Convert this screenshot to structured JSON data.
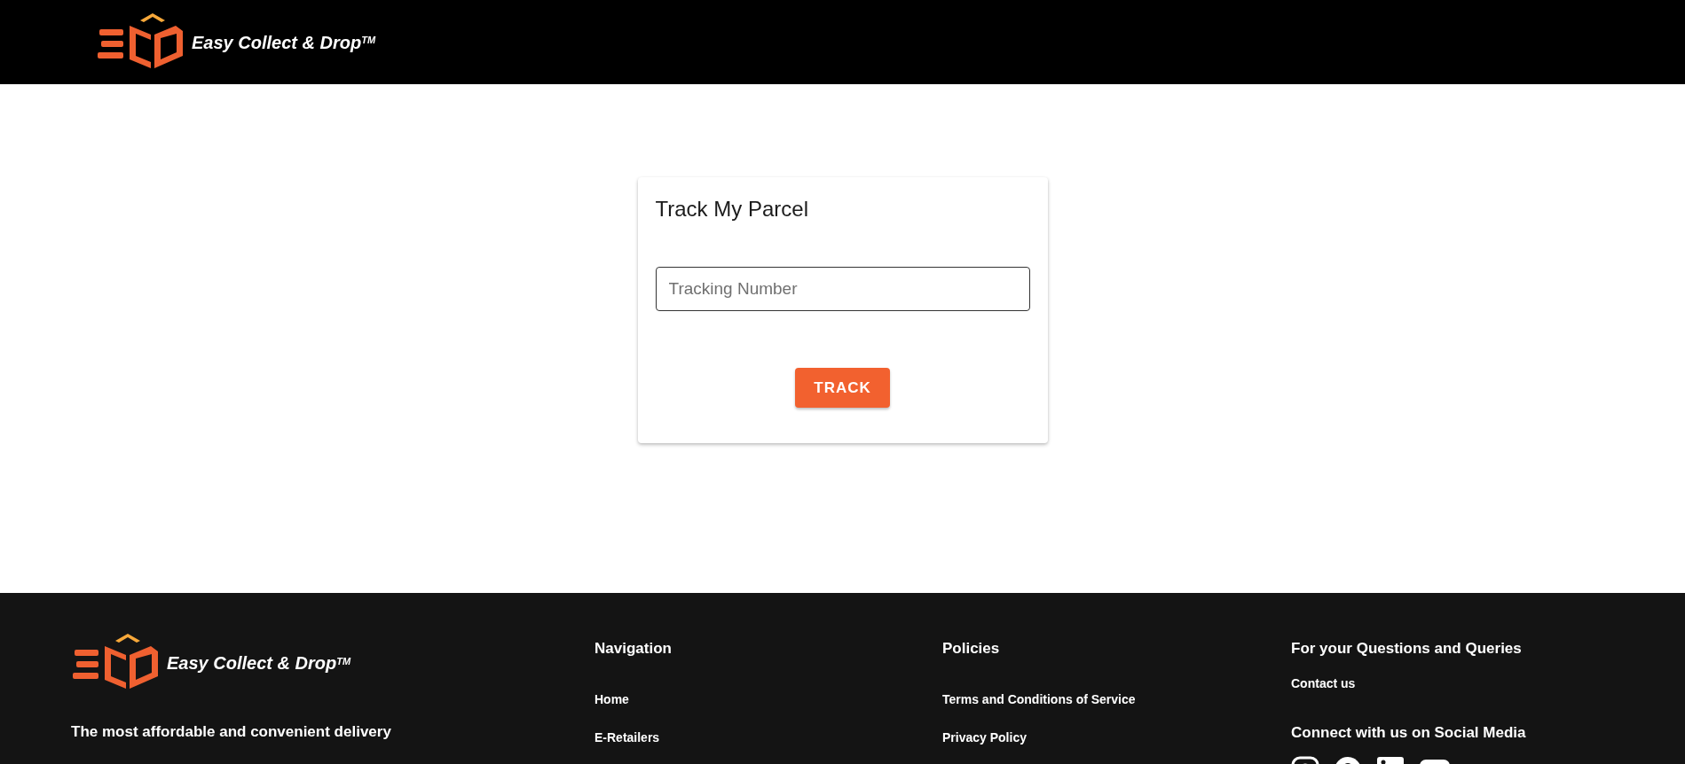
{
  "header": {
    "brand": "Easy Collect & Drop$^{TM}$"
  },
  "tracker": {
    "title": "Track My Parcel",
    "field": {
      "placeholder": "Tracking Number"
    },
    "button": "TRACK"
  },
  "footer": {
    "brand": "Easy Collect & Drop$^{TM}$",
    "tagline": "The most affordable and convenient delivery",
    "columns": [
      {
        "heading": "Navigation",
        "links": [
          "Home",
          "E-Retailers"
        ]
      },
      {
        "heading": "Policies",
        "links": [
          "Terms and Conditions of Service",
          "Privacy Policy"
        ]
      }
    ],
    "contact": {
      "heading": "For your Questions and Queries",
      "link": "Contact us",
      "social_heading": "Connect with us on Social Media"
    }
  }
}
